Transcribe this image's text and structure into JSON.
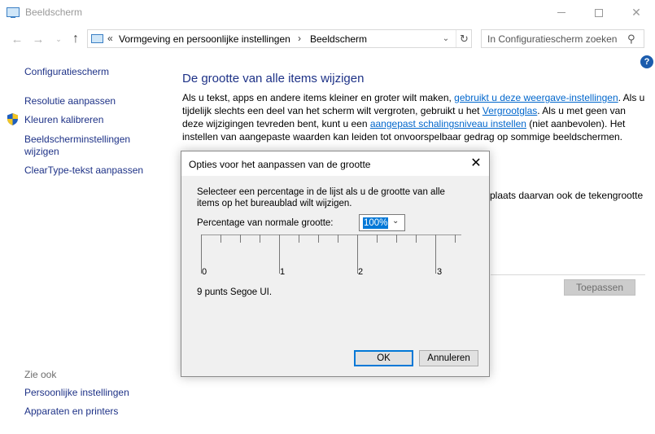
{
  "window": {
    "title": "Beeldscherm",
    "minimize_icon": "minimize-icon",
    "maximize_icon": "maximize-icon",
    "close_glyph": "✕"
  },
  "nav": {
    "back_glyph": "←",
    "forward_glyph": "→",
    "recent_glyph": "⌄",
    "up_glyph": "↑",
    "address": {
      "overflow": "«",
      "crumbs": [
        "Vormgeving en persoonlijke instellingen",
        "Beeldscherm"
      ],
      "separator": "›",
      "dropdown_glyph": "⌄",
      "refresh_glyph": "↻"
    },
    "search_placeholder": "In Configuratiescherm zoeken",
    "search_glyph": "⚲"
  },
  "help_glyph": "?",
  "sidebar": {
    "home": "Configuratiescherm",
    "items": [
      "Resolutie aanpassen",
      "Kleuren kalibreren",
      "Beeldscherminstellingen wijzigen",
      "ClearType-tekst aanpassen"
    ],
    "see_also_title": "Zie ook",
    "see_also": [
      "Persoonlijke instellingen",
      "Apparaten en printers"
    ]
  },
  "main": {
    "heading": "De grootte van alle items wijzigen",
    "para": {
      "t1": "Als u tekst, apps en andere items kleiner en groter wilt maken, ",
      "link1": "gebruikt u deze weergave-instellingen",
      "t2": ". Als u tijdelijk slechts een deel van het scherm wilt vergroten, gebruikt u het ",
      "link2": "Vergrootglas",
      "t3": ". Als u met geen van deze wijzigingen tevreden bent, kunt u een ",
      "link3": "aangepast schalingsniveau instellen",
      "t4": " (niet aanbevolen). Het instellen van aangepaste waarden kan leiden tot onvoorspelbaar gedrag op sommige beeldschermen."
    },
    "partial_text": "plaats daarvan ook de tekengrootte",
    "apply_label": "Toepassen"
  },
  "dialog": {
    "title": "Opties voor het aanpassen van de grootte",
    "close_glyph": "✕",
    "description": "Selecteer een percentage in de lijst als u de grootte van alle items op het bureaublad wilt wijzigen.",
    "percentage_label": "Percentage van normale grootte:",
    "percentage_value": "100%",
    "chevron_glyph": "⌄",
    "ruler_numbers": [
      "0",
      "1",
      "2",
      "3"
    ],
    "font_info": "9 punts Segoe UI.",
    "ok_label": "OK",
    "cancel_label": "Annuleren"
  }
}
